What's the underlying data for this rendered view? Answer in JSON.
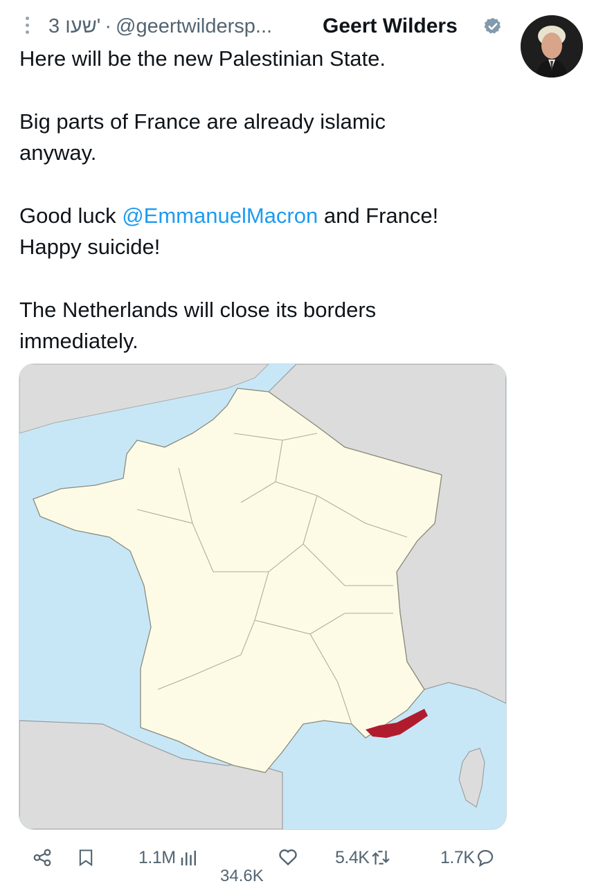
{
  "tweet": {
    "time": "3 שעו'",
    "separator": "·",
    "handle": "@geertwildersp...",
    "author_name": "Geert Wilders",
    "paragraphs": {
      "p1": "Here will be the new Palestinian State.",
      "p2a": "Big parts of France are already islamic",
      "p2b": "anyway.",
      "p3_pre": "Good luck ",
      "p3_mention": "@EmmanuelMacron",
      "p3_post": " and France!",
      "p3b": "Happy suicide!",
      "p4a": "The Netherlands will close its borders",
      "p4b": "immediately."
    }
  },
  "metrics": {
    "views": "1.1M",
    "likes": "34.6K",
    "retweets": "5.4K",
    "replies": "1.7K"
  },
  "colors": {
    "sea": "#c7e7f7",
    "france_land": "#fdfbe6",
    "other_land": "#dcdcdc",
    "highlight_region": "#b01c2e",
    "link": "#1d9bf0",
    "muted_text": "#536471"
  },
  "icons": {
    "more": "vertical-dots-icon",
    "verified": "verified-badge-icon",
    "share": "share-icon",
    "bookmark": "bookmark-icon",
    "views": "bar-chart-icon",
    "like": "heart-icon",
    "retweet": "retweet-icon",
    "reply": "reply-bubble-icon"
  }
}
